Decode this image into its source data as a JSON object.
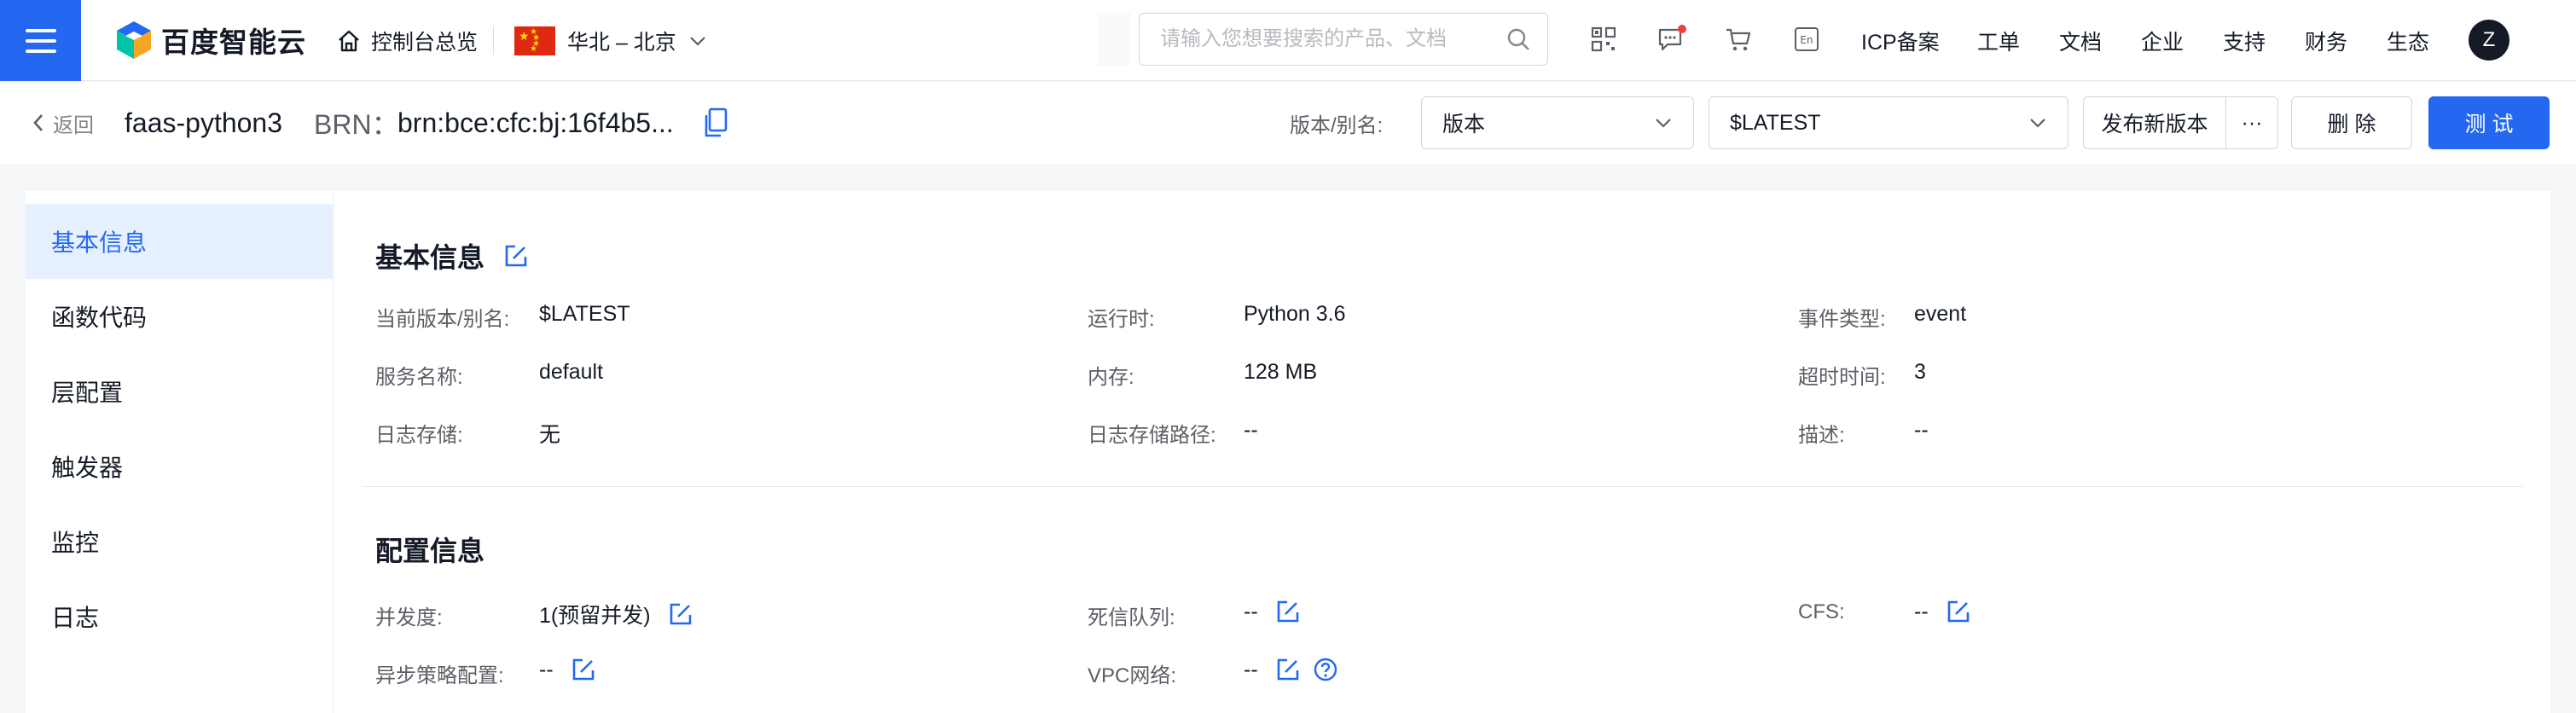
{
  "topnav": {
    "logo_text": "百度智能云",
    "overview": "控制台总览",
    "region": "华北 – 北京",
    "search_placeholder": "请输入您想要搜索的产品、文档",
    "links": [
      "ICP备案",
      "工单",
      "文档",
      "企业",
      "支持",
      "财务",
      "生态"
    ],
    "avatar": "Z",
    "en_badge": "En"
  },
  "subhead": {
    "back": "返回",
    "function_name": "faas-python3",
    "brn_label": "BRN：",
    "brn_value": "brn:bce:cfc:bj:16f4b5...",
    "version_label": "版本/别名:",
    "version_type": "版本",
    "version_value": "$LATEST",
    "publish_button": "发布新版本",
    "more_button": "···",
    "delete_button": "删 除",
    "test_button": "测 试"
  },
  "sidebar": {
    "items": [
      "基本信息",
      "函数代码",
      "层配置",
      "触发器",
      "监控",
      "日志"
    ]
  },
  "basic_info": {
    "title": "基本信息",
    "fields": [
      {
        "label": "当前版本/别名:",
        "value": "$LATEST"
      },
      {
        "label": "运行时:",
        "value": "Python 3.6"
      },
      {
        "label": "事件类型:",
        "value": "event"
      },
      {
        "label": "服务名称:",
        "value": "default"
      },
      {
        "label": "内存:",
        "value": "128 MB"
      },
      {
        "label": "超时时间:",
        "value": "3"
      },
      {
        "label": "日志存储:",
        "value": "无"
      },
      {
        "label": "日志存储路径:",
        "value": "--"
      },
      {
        "label": "描述:",
        "value": "--"
      }
    ]
  },
  "config_info": {
    "title": "配置信息",
    "fields": [
      {
        "label": "并发度:",
        "value": "1(预留并发)"
      },
      {
        "label": "死信队列:",
        "value": "--"
      },
      {
        "label": "CFS:",
        "value": "--"
      },
      {
        "label": "异步策略配置:",
        "value": "--"
      },
      {
        "label": "VPC网络:",
        "value": "--"
      }
    ]
  },
  "colors": {
    "primary": "#2468f2",
    "active_bg": "#e6f0ff",
    "notification_dot": "#f33e3e"
  }
}
